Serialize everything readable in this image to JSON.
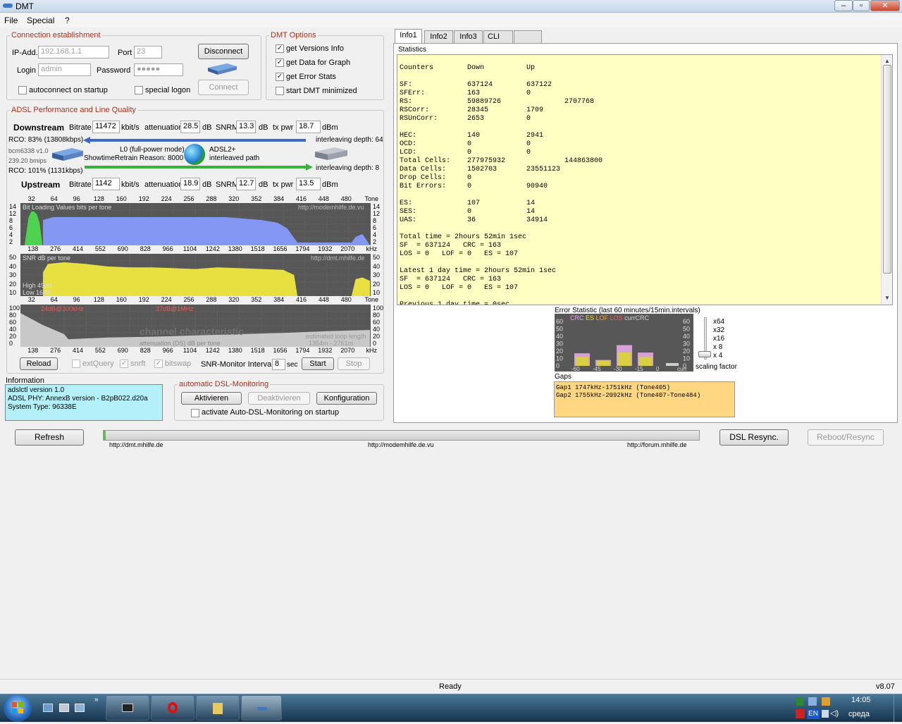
{
  "window": {
    "title": "DMT"
  },
  "menu": [
    "File",
    "Special",
    "?"
  ],
  "conn": {
    "title": "Connection establishment",
    "ip_label": "IP-Add.",
    "ip": "192.168.1.1",
    "port_label": "Port",
    "port": "23",
    "login_label": "Login",
    "login": "admin",
    "pass_label": "Password",
    "pass": "●●●●●",
    "disconnect": "Disconnect",
    "connect": "Connect",
    "autoconnect": "autoconnect on startup",
    "special_logon": "special logon"
  },
  "dmt_options": {
    "title": "DMT Options",
    "items": [
      "get Versions Info",
      "get Data for Graph",
      "get Error Stats",
      "start DMT minimized"
    ]
  },
  "adsl": {
    "title": "ADSL Performance and Line Quality",
    "downstream": "Downstream",
    "upstream": "Upstream",
    "bitrate_label": "Bitrate",
    "kbit": "kbit/s",
    "att_label": "attenuation",
    "db": "dB",
    "snrm_label": "SNRM",
    "txpwr_label": "tx pwr",
    "dbm": "dBm",
    "down_bitrate": "11472",
    "down_att": "28.5",
    "down_snrm": "13.3",
    "down_txpwr": "18.7",
    "up_bitrate": "1142",
    "up_att": "18.9",
    "up_snrm": "12.7",
    "up_txpwr": "13.5",
    "rco_down": "RCO: 83% (13808kbps)",
    "rco_up": "RCO: 101% (1131kbps)",
    "chip": "bcm6338 v1.0",
    "bmips": "239.20 bmips",
    "mode": "L0 (full-power mode)",
    "retrain": "ShowtimeRetrain Reason: 8000",
    "standard": "ADSL2+",
    "path": "interleaved path",
    "il_down": "interleaving depth: 64",
    "il_up": "interleaving depth: 8"
  },
  "charts": {
    "tone_ticks": [
      "32",
      "64",
      "96",
      "128",
      "160",
      "192",
      "224",
      "256",
      "288",
      "320",
      "352",
      "384",
      "416",
      "448",
      "480",
      "Tone"
    ],
    "khz_ticks": [
      "138",
      "276",
      "414",
      "552",
      "690",
      "828",
      "966",
      "1104",
      "1242",
      "1380",
      "1518",
      "1656",
      "1794",
      "1932",
      "2070",
      "kHz"
    ],
    "bits_axis": [
      "14",
      "12",
      "8",
      "6",
      "4",
      "2"
    ],
    "snr_axis": [
      "50",
      "40",
      "30",
      "20",
      "10"
    ],
    "att_axis": [
      "100",
      "80",
      "60",
      "40",
      "20",
      "0"
    ],
    "bits_title": "Bit Loading Values   bits per tone",
    "bits_url": "http://modemhilfe.de.vu",
    "snr_title": "SNR  dB per tone",
    "snr_url": "http://dmt.mhilfe.de",
    "snr_high": "High 49dB",
    "snr_low": "Low  16dB",
    "att_mark1": "24dB@300kHz",
    "att_mark2": "37dB@1MHz",
    "att_title": "channel characteristic",
    "att_sub": "attenuation (DS)  dB per tone",
    "loop1": "estimated loop length",
    "loop2": "1354m - 2761m"
  },
  "chart_data": [
    {
      "type": "area",
      "title": "Bit Loading Values   bits per tone",
      "xlabel": "Tone",
      "ylabel": "bits per tone",
      "ylim": [
        0,
        15
      ],
      "series": [
        {
          "name": "Upstream",
          "x": [
            6,
            12,
            16,
            20,
            24,
            28,
            32
          ],
          "values": [
            0,
            10,
            12,
            12,
            11,
            8,
            0
          ]
        },
        {
          "name": "Downstream",
          "x": [
            33,
            48,
            96,
            128,
            192,
            256,
            300,
            352,
            376,
            390,
            405,
            484,
            490,
            500,
            511
          ],
          "values": [
            9,
            10,
            10,
            10,
            10,
            10,
            10,
            9,
            8,
            6,
            1,
            1,
            3,
            4,
            0
          ]
        }
      ]
    },
    {
      "type": "area",
      "title": "SNR  dB per tone",
      "xlabel": "Tone",
      "ylabel": "dB per tone",
      "ylim": [
        0,
        50
      ],
      "series": [
        {
          "name": "SNR",
          "x": [
            33,
            40,
            64,
            96,
            128,
            160,
            192,
            224,
            256,
            288,
            320,
            352,
            384,
            400,
            405,
            484,
            490,
            500,
            511
          ],
          "values": [
            28,
            38,
            40,
            38,
            35,
            34,
            34,
            33,
            32,
            34,
            33,
            32,
            31,
            25,
            0,
            0,
            20,
            22,
            18
          ]
        }
      ]
    },
    {
      "type": "area",
      "title": "channel characteristic",
      "xlabel": "Tone",
      "ylabel": "attenuation (DS)  dB per tone",
      "ylim": [
        0,
        100
      ],
      "series": [
        {
          "name": "attenuation",
          "x": [
            0,
            32,
            64,
            70,
            96,
            128,
            192,
            256,
            320,
            384,
            448,
            511
          ],
          "values": [
            80,
            52,
            30,
            18,
            20,
            22,
            24,
            27,
            30,
            33,
            37,
            40
          ]
        }
      ]
    },
    {
      "type": "bar",
      "title": "Error Statistic (last 60 minutes/15min.intervals)",
      "categories": [
        "-60",
        "-45",
        "-30",
        "-15",
        "0"
      ],
      "series": [
        {
          "name": "CRC",
          "values": [
            17,
            8,
            28,
            18,
            0
          ]
        },
        {
          "name": "ES",
          "values": [
            12,
            7,
            18,
            12,
            0
          ]
        },
        {
          "name": "LOF",
          "values": [
            0,
            0,
            0,
            0,
            0
          ]
        },
        {
          "name": "LOS",
          "values": [
            0,
            0,
            0,
            0,
            0
          ]
        }
      ],
      "ylim": [
        0,
        60
      ]
    }
  ],
  "bottom_ctrl": {
    "reload": "Reload",
    "extquery": "extQuery",
    "snrft": "snrft",
    "bitswap": "bitswap",
    "snr_interval_label": "SNR-Monitor Interval:",
    "snr_interval": "8",
    "sec": "sec",
    "start": "Start",
    "stop": "Stop"
  },
  "info": {
    "title": "Information",
    "lines": [
      "adslctl version 1.0",
      "ADSL PHY: AnnexB version - B2pB022.d20a",
      "System Type: 96338E"
    ]
  },
  "auto": {
    "title": "automatic DSL-Monitoring",
    "aktivieren": "Aktivieren",
    "deaktivieren": "Deaktivieren",
    "konfig": "Konfiguration",
    "startup": "activate Auto-DSL-Monitoring on startup"
  },
  "tabs": [
    "Info1",
    "Info2",
    "Info3",
    "CLI",
    ""
  ],
  "statistics": {
    "label": "Statistics",
    "text": "Counters        Down          Up\n\nSF:             637124        637122\nSFErr:          163           0\nRS:             59889726               2707768\nRSCorr:         28345         1709\nRSUnCorr:       2653          0\n\nHEC:            140           2941\nOCD:            0             0\nLCD:            0             0\nTotal Cells:    277975932              144863800\nData Cells:     1502703       23551123\nDrop Cells:     0\nBit Errors:     0             90940\n\nES:             107           14\nSES:            0             14\nUAS:            36            34914\n\nTotal time = 2hours 52min 1sec\nSF  = 637124   CRC = 163\nLOS = 0   LOF = 0   ES = 107\n\nLatest 1 day time = 2hours 52min 1sec\nSF  = 637124   CRC = 163\nLOS = 0   LOF = 0   ES = 107\n\nPrevious 1 day time = 0sec"
  },
  "errstat": {
    "title": "Error Statistic (last 60 minutes/15min.intervals)",
    "legend": [
      "CRC",
      "ES",
      "LOF",
      "LOS",
      "currCRC"
    ],
    "axis": [
      "60",
      "50",
      "40",
      "30",
      "20",
      "10",
      "0"
    ],
    "xlabels": [
      "-60",
      "-45",
      "-30",
      "-15",
      "0",
      "curr"
    ],
    "scales": [
      "x64",
      "x32",
      "x16",
      "x 8",
      "x 4"
    ],
    "scaling": "scaling factor"
  },
  "gaps": {
    "label": "Gaps",
    "lines": [
      "Gap1 1747kHz-1751kHz (Tone405)",
      "Gap2 1755kHz-2092kHz (Tone407-Tone484)"
    ]
  },
  "footer": {
    "refresh": "Refresh",
    "resync": "DSL Resync.",
    "reboot": "Reboot/Resync",
    "link1": "http://dmt.mhilfe.de",
    "link2": "http://modemhilfe.de.vu",
    "link3": "http://forum.mhilfe.de",
    "status": "Ready",
    "version": "v8.07"
  },
  "taskbar": {
    "lang": "EN",
    "time": "14:05",
    "day": "среда"
  },
  "colors": {
    "accent_label": "#b0301b",
    "down_bits": "#8397f3",
    "up_bits": "#4fd24f",
    "snr": "#e8e040",
    "att": "#c8c8c8",
    "stat_bg": "#ffffc4",
    "info_bg": "#b4f0fa",
    "gaps_bg": "#ffd682"
  }
}
